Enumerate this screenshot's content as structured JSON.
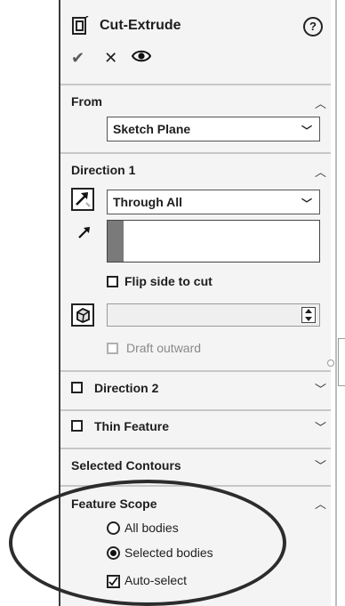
{
  "header": {
    "title": "Cut-Extrude"
  },
  "from": {
    "title": "From",
    "selected": "Sketch Plane"
  },
  "direction1": {
    "title": "Direction 1",
    "end_condition": "Through All",
    "flip_label": "Flip side to cut",
    "draft_outward_label": "Draft outward"
  },
  "direction2": {
    "title": "Direction 2"
  },
  "thin_feature": {
    "title": "Thin Feature"
  },
  "selected_contours": {
    "title": "Selected Contours"
  },
  "feature_scope": {
    "title": "Feature Scope",
    "all_bodies": "All bodies",
    "selected_bodies": "Selected bodies",
    "auto_select": "Auto-select"
  },
  "icons": {
    "title": "cut-extrude-icon",
    "help": "help-icon",
    "ok": "check-icon",
    "cancel": "close-icon",
    "preview": "eye-icon",
    "reverse": "reverse-direction-icon",
    "direction": "direction-arrow-icon",
    "draft": "draft-icon",
    "caret_up": "chevron-up-icon",
    "caret_down": "chevron-down-icon"
  },
  "colors": {
    "panel": "#f4f4f4",
    "annotation": "#2c2c2c"
  }
}
